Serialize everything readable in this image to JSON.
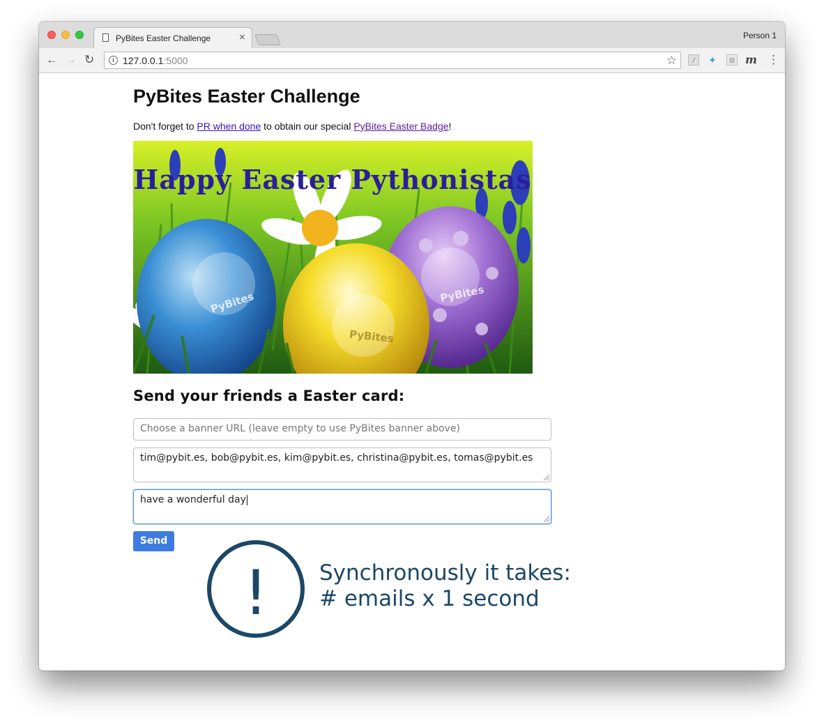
{
  "browser": {
    "tab_title": "PyBites Easter Challenge",
    "tab_close": "×",
    "profile": "Person 1",
    "url_host": "127.0.0.1",
    "url_port": ":5000",
    "icons": {
      "back": "arrow-left-icon",
      "forward": "arrow-right-icon",
      "reload": "reload-icon",
      "info": "info-icon",
      "bookmark": "star-icon",
      "menu": "kebab-menu-icon"
    }
  },
  "page": {
    "title": "PyBites Easter Challenge",
    "intro": {
      "before": "Don't forget to ",
      "link1": "PR when done",
      "middle": " to obtain our special ",
      "link2": "PyBites Easter Badge",
      "after": "!"
    },
    "banner": {
      "headline": "Happy Easter Pythonistas",
      "egg_logo": "PyBites"
    },
    "subtitle": "Send your friends a Easter card:",
    "form": {
      "banner_placeholder": "Choose a banner URL (leave empty to use PyBites banner above)",
      "emails_value": "tim@pybit.es, bob@pybit.es, kim@pybit.es, christina@pybit.es, tomas@pybit.es",
      "message_value": "have a wonderful day",
      "send_label": "Send"
    }
  },
  "annotation": {
    "symbol": "!",
    "line1": "Synchronously it takes:",
    "line2": "# emails x 1 second",
    "color": "#1c4766"
  },
  "colors": {
    "link": "#3b0fc0",
    "button": "#3e7be0",
    "focus_border": "#5b8fd8"
  }
}
